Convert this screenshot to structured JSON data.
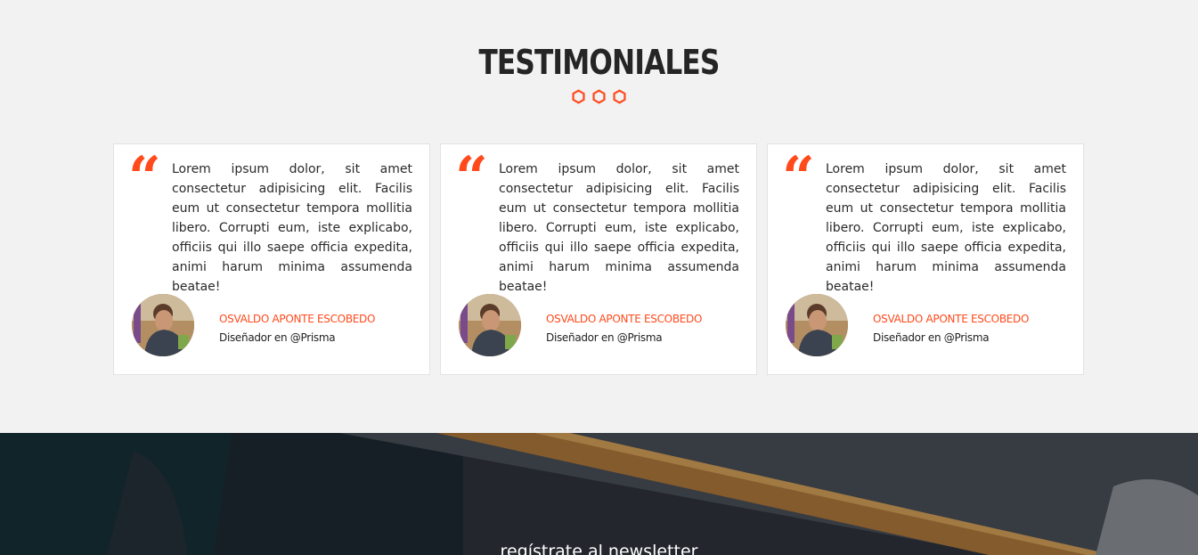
{
  "section": {
    "title": "TESTIMONIALES",
    "accent_color": "#ff4a1c"
  },
  "testimonials": [
    {
      "quote_mark": "“",
      "text": "Lorem ipsum dolor, sit amet consectetur adipisicing elit. Facilis eum ut consectetur tempora mollitia libero. Corrupti eum, iste explicabo, officiis qui illo saepe officia expedita, animi harum minima assumenda beatae!",
      "name": "OSVALDO APONTE ESCOBEDO",
      "role": "Diseñador en @Prisma"
    },
    {
      "quote_mark": "“",
      "text": "Lorem ipsum dolor, sit amet consectetur adipisicing elit. Facilis eum ut consectetur tempora mollitia libero. Corrupti eum, iste explicabo, officiis qui illo saepe officia expedita, animi harum minima assumenda beatae!",
      "name": "OSVALDO APONTE ESCOBEDO",
      "role": "Diseñador en @Prisma"
    },
    {
      "quote_mark": "“",
      "text": "Lorem ipsum dolor, sit amet consectetur adipisicing elit. Facilis eum ut consectetur tempora mollitia libero. Corrupti eum, iste explicabo, officiis qui illo saepe officia expedita, animi harum minima assumenda beatae!",
      "name": "OSVALDO APONTE ESCOBEDO",
      "role": "Diseñador en @Prisma"
    }
  ],
  "newsletter": {
    "title": "regístrate al newsletter"
  }
}
